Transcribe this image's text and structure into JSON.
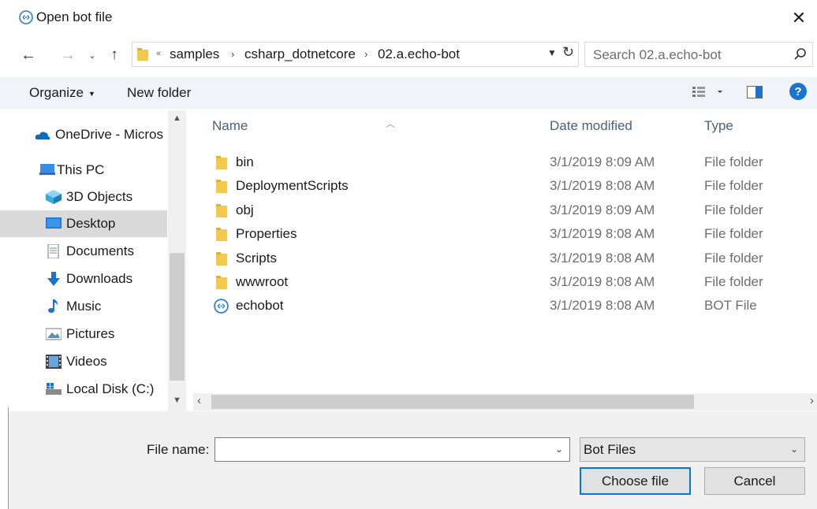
{
  "window": {
    "title": "Open bot file",
    "close_icon": "close-icon"
  },
  "address": {
    "overflow_marker": "«",
    "crumbs": [
      "samples",
      "csharp_dotnetcore",
      "02.a.echo-bot"
    ],
    "separator": "›"
  },
  "search": {
    "placeholder": "Search 02.a.echo-bot"
  },
  "toolbar": {
    "organize_label": "Organize",
    "new_folder_label": "New folder",
    "help_label": "?"
  },
  "nav_pane": {
    "items": [
      {
        "label": "OneDrive - Micros",
        "icon": "cloud-icon"
      },
      {
        "label": "This PC",
        "icon": "computer-icon"
      },
      {
        "label": "3D Objects",
        "icon": "cube-icon"
      },
      {
        "label": "Desktop",
        "icon": "desktop-icon",
        "selected": true
      },
      {
        "label": "Documents",
        "icon": "document-icon"
      },
      {
        "label": "Downloads",
        "icon": "download-icon"
      },
      {
        "label": "Music",
        "icon": "music-note-icon"
      },
      {
        "label": "Pictures",
        "icon": "picture-icon"
      },
      {
        "label": "Videos",
        "icon": "film-icon"
      },
      {
        "label": "Local Disk (C:)",
        "icon": "disk-icon"
      }
    ]
  },
  "file_list": {
    "columns": {
      "name": "Name",
      "date": "Date modified",
      "type": "Type"
    },
    "rows": [
      {
        "name": "bin",
        "date": "3/1/2019 8:09 AM",
        "type": "File folder",
        "icon": "folder-icon"
      },
      {
        "name": "DeploymentScripts",
        "date": "3/1/2019 8:08 AM",
        "type": "File folder",
        "icon": "folder-icon"
      },
      {
        "name": "obj",
        "date": "3/1/2019 8:09 AM",
        "type": "File folder",
        "icon": "folder-icon"
      },
      {
        "name": "Properties",
        "date": "3/1/2019 8:08 AM",
        "type": "File folder",
        "icon": "folder-icon"
      },
      {
        "name": "Scripts",
        "date": "3/1/2019 8:08 AM",
        "type": "File folder",
        "icon": "folder-icon"
      },
      {
        "name": "wwwroot",
        "date": "3/1/2019 8:08 AM",
        "type": "File folder",
        "icon": "folder-icon"
      },
      {
        "name": "echobot",
        "date": "3/1/2019 8:08 AM",
        "type": "BOT File",
        "icon": "bot-file-icon"
      }
    ]
  },
  "footer": {
    "file_name_label": "File name:",
    "file_name_value": "",
    "file_type_selected": "Bot Files",
    "choose_label": "Choose file",
    "cancel_label": "Cancel"
  },
  "colors": {
    "accent": "#0078d7",
    "folder": "#f2c94c",
    "toolbar_bg": "#f0f4f9",
    "selected_bg": "#d9d9d9"
  }
}
